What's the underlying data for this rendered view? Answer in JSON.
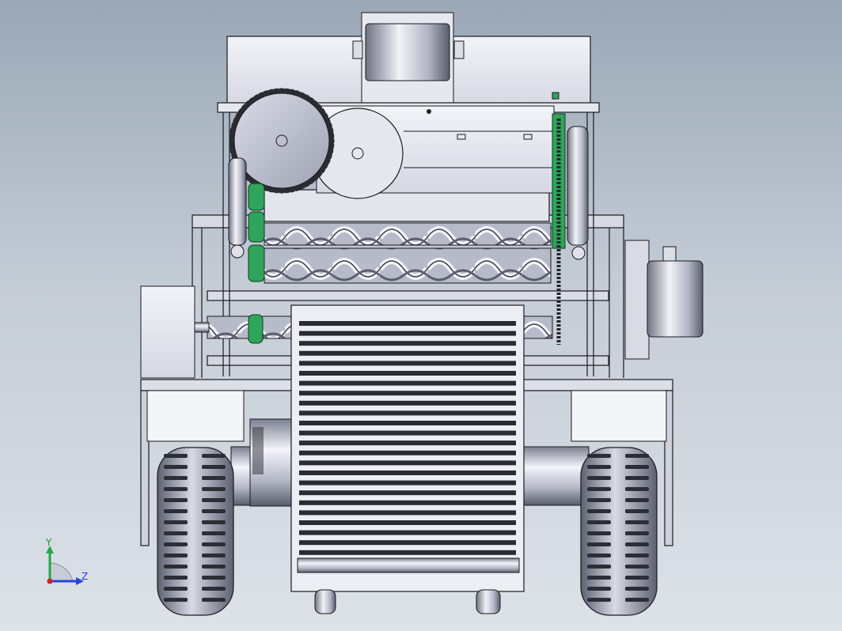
{
  "triad": {
    "y_label": "Y",
    "z_label": "Z"
  },
  "colors": {
    "background_top": "#9aa7b5",
    "background_bottom": "#dde2e8",
    "metal_light": "#ececf4",
    "metal_mid": "#b9bccb",
    "metal_dark": "#5d6170",
    "edge": "#1a1a1e",
    "green_parts": "#2fa45a",
    "axis_x": "#d0202a",
    "axis_y": "#22a84a",
    "axis_z": "#2b46d8"
  },
  "icons": {
    "triad": "coordinate-triad-icon"
  }
}
